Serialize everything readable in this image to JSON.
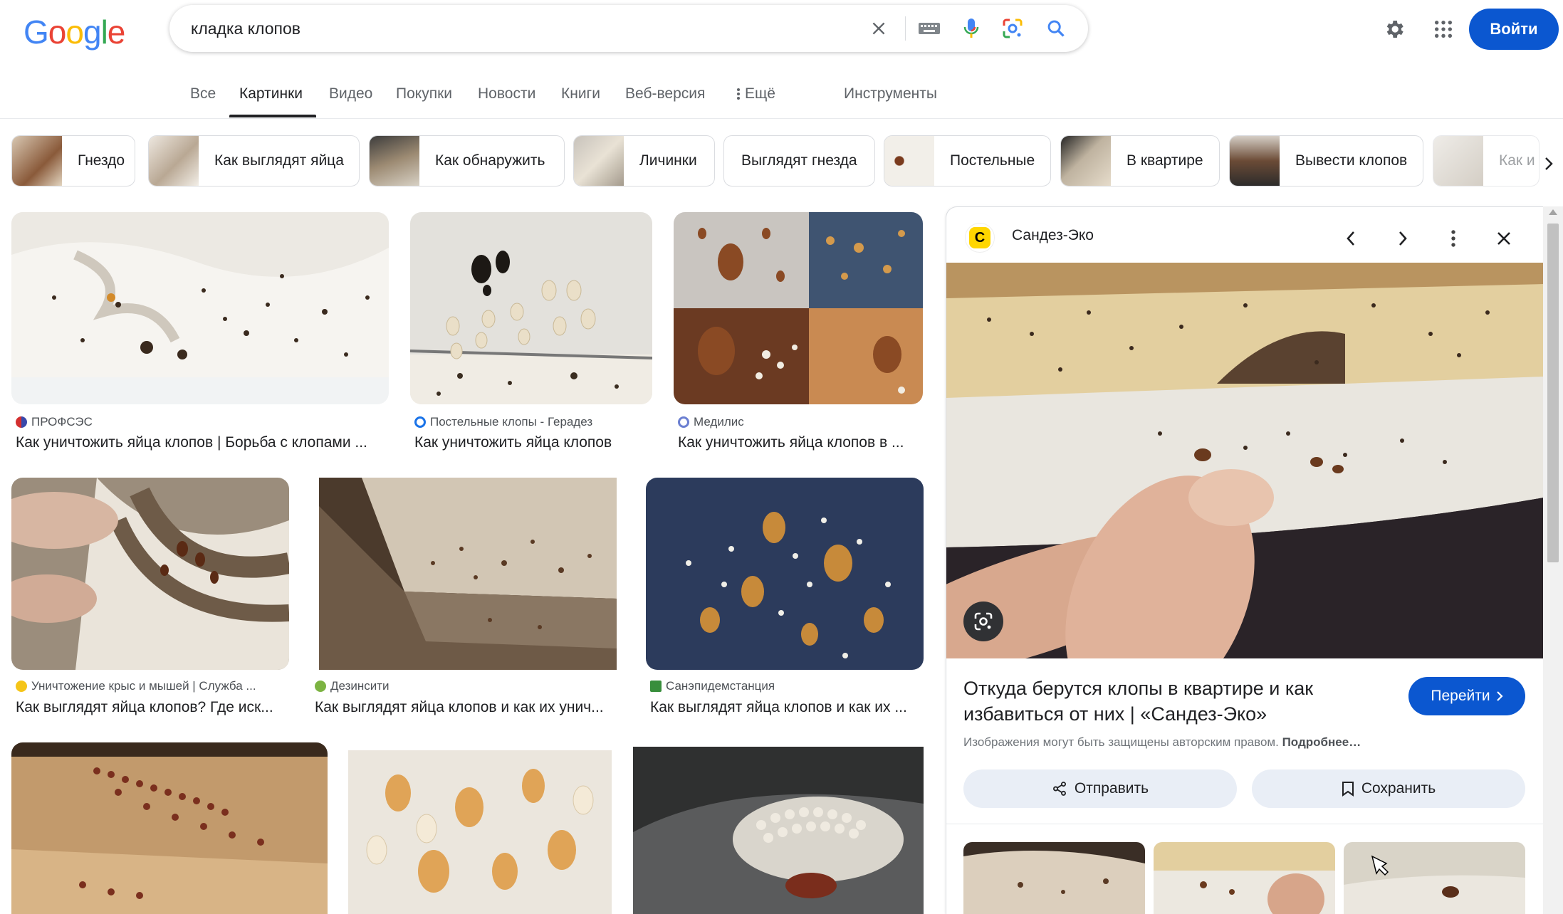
{
  "logo": [
    "G",
    "o",
    "o",
    "g",
    "l",
    "e"
  ],
  "search": {
    "query": "кладка клопов"
  },
  "header": {
    "signin_label": "Войти"
  },
  "tabs": [
    {
      "label": "Все"
    },
    {
      "label": "Картинки"
    },
    {
      "label": "Видео"
    },
    {
      "label": "Покупки"
    },
    {
      "label": "Новости"
    },
    {
      "label": "Книги"
    },
    {
      "label": "Веб-версия"
    },
    {
      "label": "Ещё"
    },
    {
      "label": "Инструменты"
    }
  ],
  "chips": [
    {
      "label": "Гнездо"
    },
    {
      "label": "Как выглядят яйца"
    },
    {
      "label": "Как обнаружить"
    },
    {
      "label": "Личинки"
    },
    {
      "label": "Выглядят гнезда"
    },
    {
      "label": "Постельные"
    },
    {
      "label": "В квартире"
    },
    {
      "label": "Вывести клопов"
    },
    {
      "label": "Как и"
    }
  ],
  "results": [
    {
      "source": "ПРОФСЭС",
      "title": "Как уничтожить яйца клопов | Борьба с клопами ..."
    },
    {
      "source": "Постельные клопы - Герадез",
      "title": "Как уничтожить яйца клопов"
    },
    {
      "source": "Медилис",
      "title": "Как уничтожить яйца клопов в ..."
    },
    {
      "source": "Уничтожение крыс и мышей | Служба ...",
      "title": "Как выглядят яйца клопов? Где иск..."
    },
    {
      "source": "Дезинсити",
      "title": "Как выглядят яйца клопов и как их унич..."
    },
    {
      "source": "Санэпидемстанция",
      "title": "Как выглядят яйца клопов и как их ..."
    }
  ],
  "panel": {
    "source": "Сандез-Эко",
    "logo_letter": "C",
    "title": "Откуда берутся клопы в квартире и как избавиться от них | «Сандез-Эко»",
    "goto_label": "Перейти",
    "copyright": "Изображения могут быть защищены авторским правом.",
    "more_label": "Подробнее…",
    "share_label": "Отправить",
    "save_label": "Сохранить"
  },
  "colors": {
    "accent": "#0b57d0",
    "chip_border": "#dadce0",
    "action_bg": "#e9eef6"
  }
}
